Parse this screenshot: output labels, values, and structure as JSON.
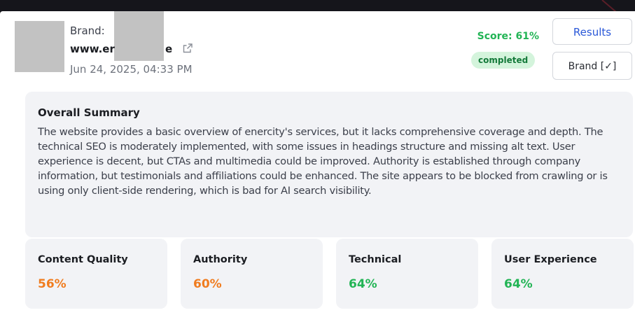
{
  "header": {
    "brand_label": "Brand:",
    "domain_start": "www.er",
    "domain_end": "e",
    "date": "Jun 24, 2025, 04:33 PM",
    "score": "Score: 61%",
    "status": "completed",
    "results_button": "Results",
    "brand_button": "Brand [✓]"
  },
  "summary": {
    "title": "Overall Summary",
    "text": "The website provides a basic overview of enercity's services, but it lacks comprehensive coverage and depth. The technical SEO is moderately implemented, with some issues in headings structure and missing alt text. User experience is decent, but CTAs and multimedia could be improved. Authority is established through company information, but testimonials and affiliations could be enhanced. The site appears to be blocked from crawling or is using only client-side rendering, which is bad for AI search visibility."
  },
  "metrics": [
    {
      "label": "Content Quality",
      "value": "56%",
      "color": "#f07c1f"
    },
    {
      "label": "Authority",
      "value": "60%",
      "color": "#f07c1f"
    },
    {
      "label": "Technical",
      "value": "64%",
      "color": "#22b455"
    },
    {
      "label": "User Experience",
      "value": "64%",
      "color": "#22b455"
    }
  ],
  "colors": {
    "score_green": "#22b455",
    "accent_blue": "#2a58d8",
    "warning_orange": "#f07c1f",
    "badge_bg": "#d4f4dc"
  }
}
